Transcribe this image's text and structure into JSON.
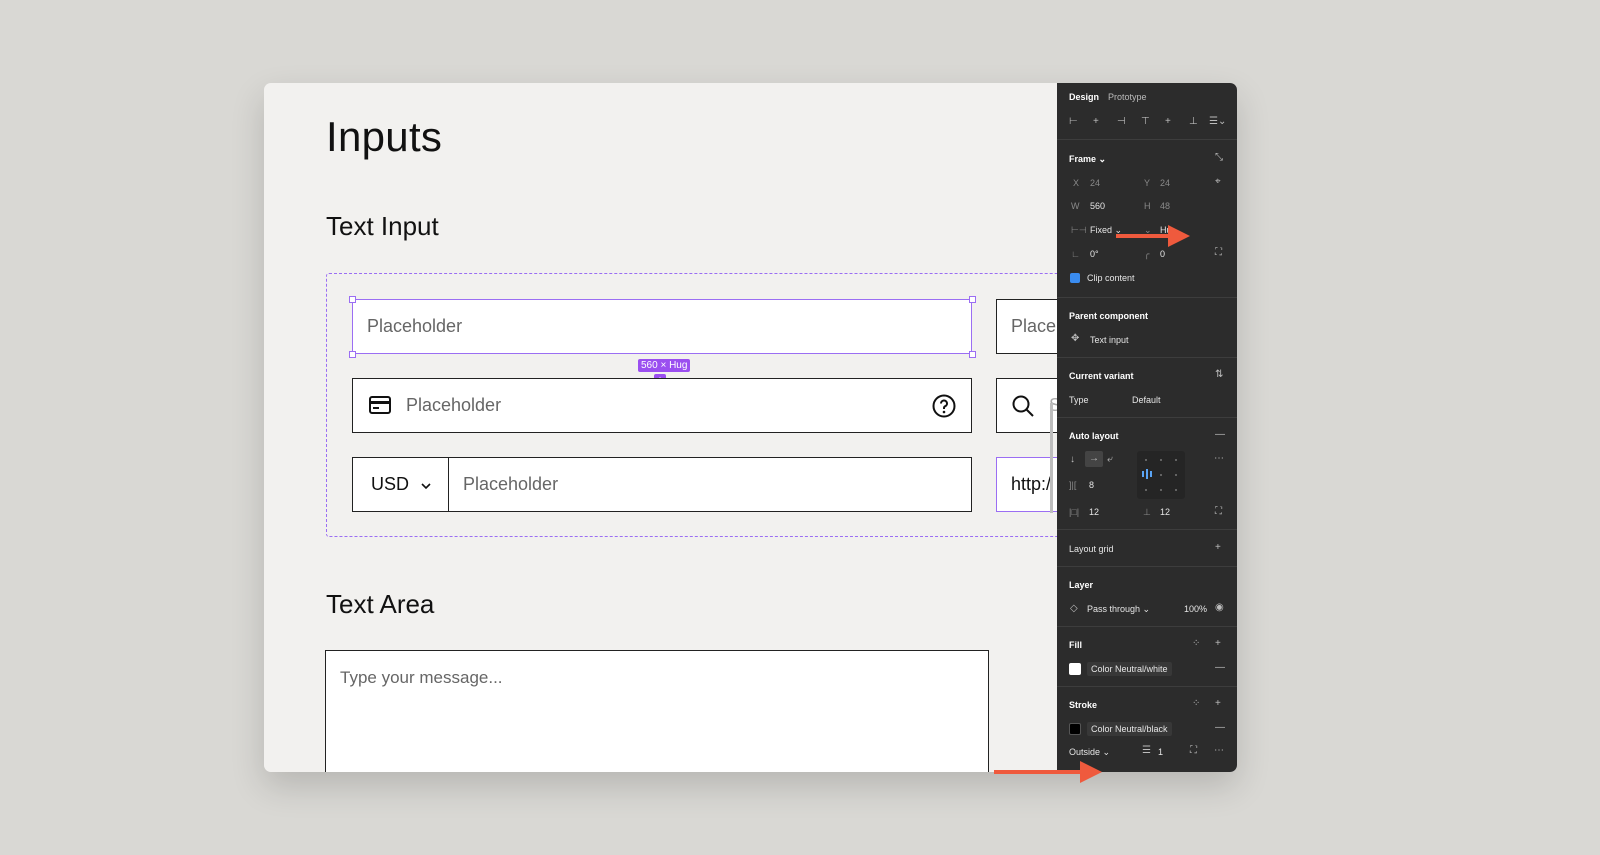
{
  "canvas": {
    "page_title": "Inputs",
    "section_text_input": "Text Input",
    "section_text_area": "Text Area",
    "input1_placeholder": "Placeholder",
    "input1_right_placeholder": "Placel",
    "size_badge": "560 × Hug",
    "input2_placeholder": "Placeholder",
    "input2_right_partial": "S",
    "currency": "USD",
    "input3_placeholder": "Placeholder",
    "url_prefix": "http:/",
    "textarea_placeholder": "Type your message..."
  },
  "panel": {
    "tabs": [
      "Design",
      "Prototype"
    ],
    "frame": {
      "label": "Frame",
      "x_label": "X",
      "x": "24",
      "y_label": "Y",
      "y": "24",
      "w_label": "W",
      "w": "560",
      "h_label": "H",
      "h": "48",
      "width_mode": "Fixed",
      "height_mode": "Hu",
      "rotation": "0°",
      "radius": "0",
      "clip_content": "Clip content"
    },
    "parent_component": {
      "label": "Parent component",
      "name": "Text input"
    },
    "current_variant": {
      "label": "Current variant",
      "type_label": "Type",
      "type_value": "Default"
    },
    "auto_layout": {
      "label": "Auto layout",
      "gap": "8",
      "padding_h": "12",
      "padding_v": "12"
    },
    "layout_grid": {
      "label": "Layout grid"
    },
    "layer": {
      "label": "Layer",
      "blend": "Pass through",
      "opacity": "100%"
    },
    "fill": {
      "label": "Fill",
      "style": "Color Neutral/white",
      "color": "#ffffff"
    },
    "stroke": {
      "label": "Stroke",
      "style": "Color Neutral/black",
      "color": "#000000",
      "position": "Outside",
      "weight": "1"
    }
  },
  "colors": {
    "accent": "#9b6ef3",
    "arrow": "#ef5a3d",
    "panel_bg": "#2c2c2c"
  }
}
